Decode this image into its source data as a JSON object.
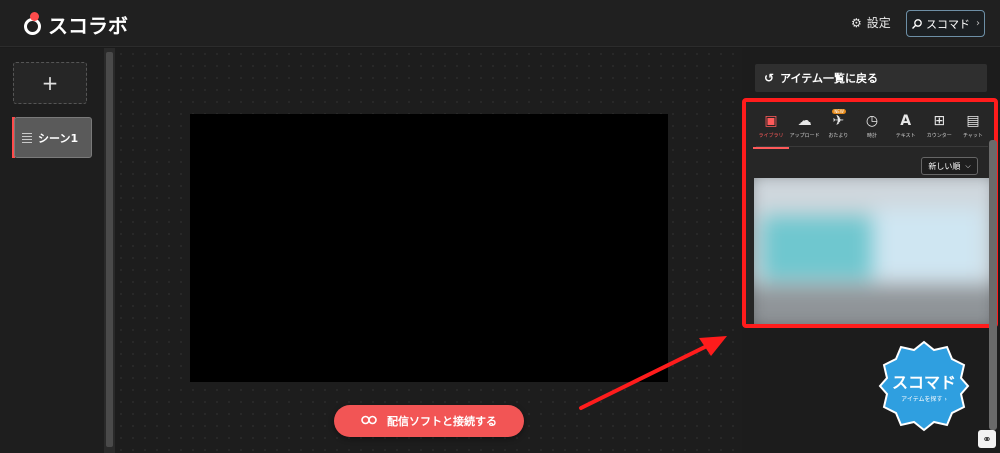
{
  "header": {
    "logo_text": "スコラボ",
    "settings_label": "設定",
    "sukomado_label": "スコマド"
  },
  "sidebar": {
    "add_label": "+",
    "scenes": [
      {
        "label": "シーン1"
      }
    ]
  },
  "canvas": {
    "connect_label": "配信ソフトと接続する"
  },
  "right_panel": {
    "back_label": "アイテム一覧に戻る",
    "tabs": [
      {
        "label": "ライブラリ",
        "icon": "library-icon",
        "active": true
      },
      {
        "label": "アップロード",
        "icon": "upload-cloud-icon"
      },
      {
        "label": "おたより",
        "icon": "paper-plane-icon",
        "badge": "NEW"
      },
      {
        "label": "時計",
        "icon": "clock-icon"
      },
      {
        "label": "テキスト",
        "icon": "text-icon"
      },
      {
        "label": "カウンター",
        "icon": "counter-icon"
      },
      {
        "label": "チャット",
        "icon": "chat-icon"
      }
    ],
    "sort_label": "新しい順"
  },
  "badge": {
    "title": "スコマド",
    "subtitle": "アイテムを探す ›"
  },
  "colors": {
    "accent": "#ff4b4b",
    "highlight_box": "#ff1c1c",
    "badge_blue": "#2f9fe0"
  }
}
